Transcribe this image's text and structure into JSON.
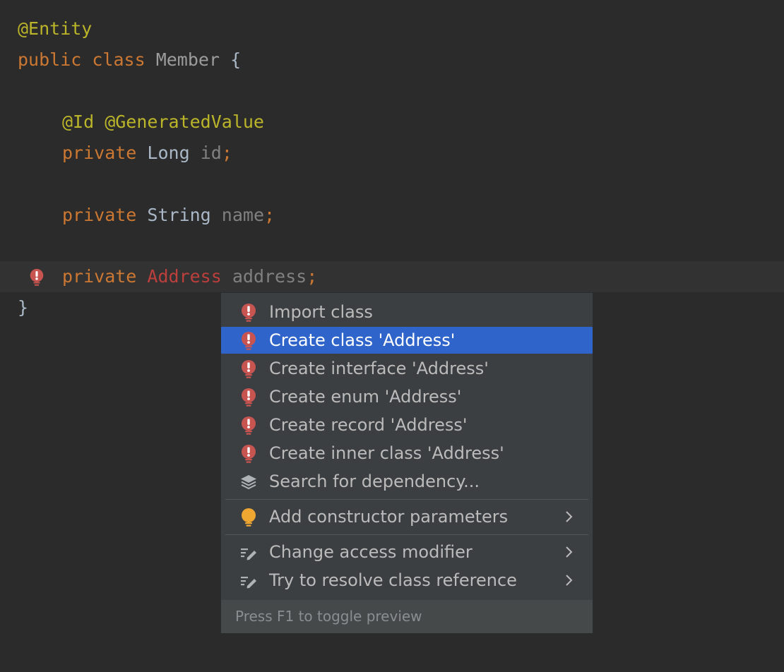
{
  "editor": {
    "lines": {
      "entity_annotation": "@Entity",
      "class_keyword_public": "public",
      "class_keyword_class": "class",
      "class_name": "Member",
      "class_open_brace": "{",
      "id_annotations": "@Id @GeneratedValue",
      "kw_private": "private",
      "type_long": "Long",
      "field_id": "id",
      "type_string": "String",
      "field_name": "name",
      "type_address": "Address",
      "field_address": "address",
      "semicolon": ";",
      "class_close_brace": "}"
    }
  },
  "intention_menu": {
    "items": [
      {
        "label": "Import class",
        "icon": "error-bulb-icon"
      },
      {
        "label": "Create class 'Address'",
        "icon": "error-bulb-icon",
        "selected": true
      },
      {
        "label": "Create interface 'Address'",
        "icon": "error-bulb-icon"
      },
      {
        "label": "Create enum 'Address'",
        "icon": "error-bulb-icon"
      },
      {
        "label": "Create record 'Address'",
        "icon": "error-bulb-icon"
      },
      {
        "label": "Create inner class 'Address'",
        "icon": "error-bulb-icon"
      },
      {
        "label": "Search for dependency...",
        "icon": "layers-icon"
      },
      {
        "label": "Add constructor parameters",
        "icon": "intention-bulb-icon",
        "submenu": true
      },
      {
        "label": "Change access modifier",
        "icon": "edit-lines-icon",
        "submenu": true
      },
      {
        "label": "Try to resolve class reference",
        "icon": "edit-lines-icon",
        "submenu": true
      }
    ],
    "footer": "Press F1 to toggle preview"
  },
  "colors": {
    "editor_bg": "#2b2b2b",
    "current_line_bg": "#323232",
    "popup_bg": "#3c3f41",
    "selection_bg": "#2f65ca",
    "error_red": "#bc3f3c",
    "keyword_orange": "#cc7832",
    "annotation_yellow": "#bbb529",
    "intention_yellow": "#f0a732"
  }
}
